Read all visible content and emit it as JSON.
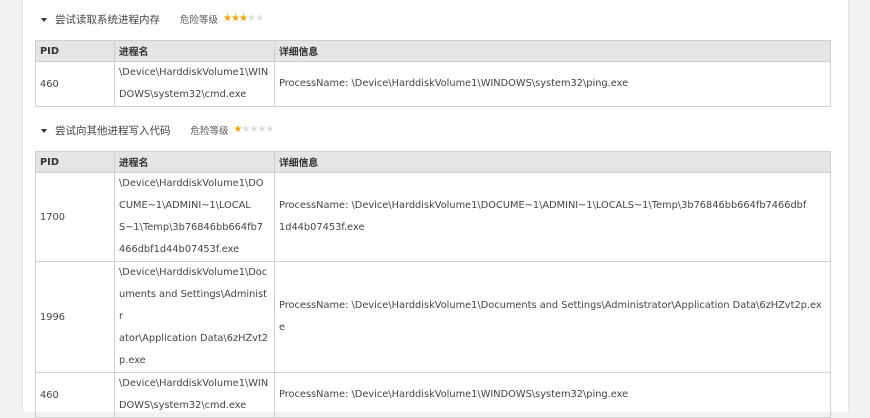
{
  "sections": [
    {
      "title": "尝试读取系统进程内存",
      "risk_label": "危险等级",
      "risk_stars": 3,
      "columns": [
        "PID",
        "进程名",
        "详细信息"
      ],
      "rows": [
        {
          "pid": "460",
          "name_lines": [
            "\\Device\\HarddiskVolume1\\WIN",
            "DOWS\\system32\\cmd.exe"
          ],
          "detail_lines": [
            "ProcessName: \\Device\\HarddiskVolume1\\WINDOWS\\system32\\ping.exe"
          ]
        }
      ]
    },
    {
      "title": "尝试向其他进程写入代码",
      "risk_label": "危险等级",
      "risk_stars": 1,
      "columns": [
        "PID",
        "进程名",
        "详细信息"
      ],
      "rows": [
        {
          "pid": "1700",
          "name_lines": [
            "\\Device\\HarddiskVolume1\\DO",
            "CUME~1\\ADMINI~1\\LOCAL",
            "S~1\\Temp\\3b76846bb664fb7",
            "466dbf1d44b07453f.exe"
          ],
          "detail_lines": [
            "ProcessName: \\Device\\HarddiskVolume1\\DOCUME~1\\ADMINI~1\\LOCALS~1\\Temp\\3b76846bb664fb7466dbf",
            "1d44b07453f.exe"
          ]
        },
        {
          "pid": "1996",
          "name_lines": [
            "\\Device\\HarddiskVolume1\\Doc",
            "uments and Settings\\Administr",
            "ator\\Application Data\\6zHZvt2",
            "p.exe"
          ],
          "detail_lines": [
            "ProcessName: \\Device\\HarddiskVolume1\\Documents and Settings\\Administrator\\Application Data\\6zHZvt2p.ex",
            "e"
          ]
        },
        {
          "pid": "460",
          "name_lines": [
            "\\Device\\HarddiskVolume1\\WIN",
            "DOWS\\system32\\cmd.exe"
          ],
          "detail_lines": [
            "ProcessName: \\Device\\HarddiskVolume1\\WINDOWS\\system32\\ping.exe"
          ]
        }
      ]
    }
  ]
}
